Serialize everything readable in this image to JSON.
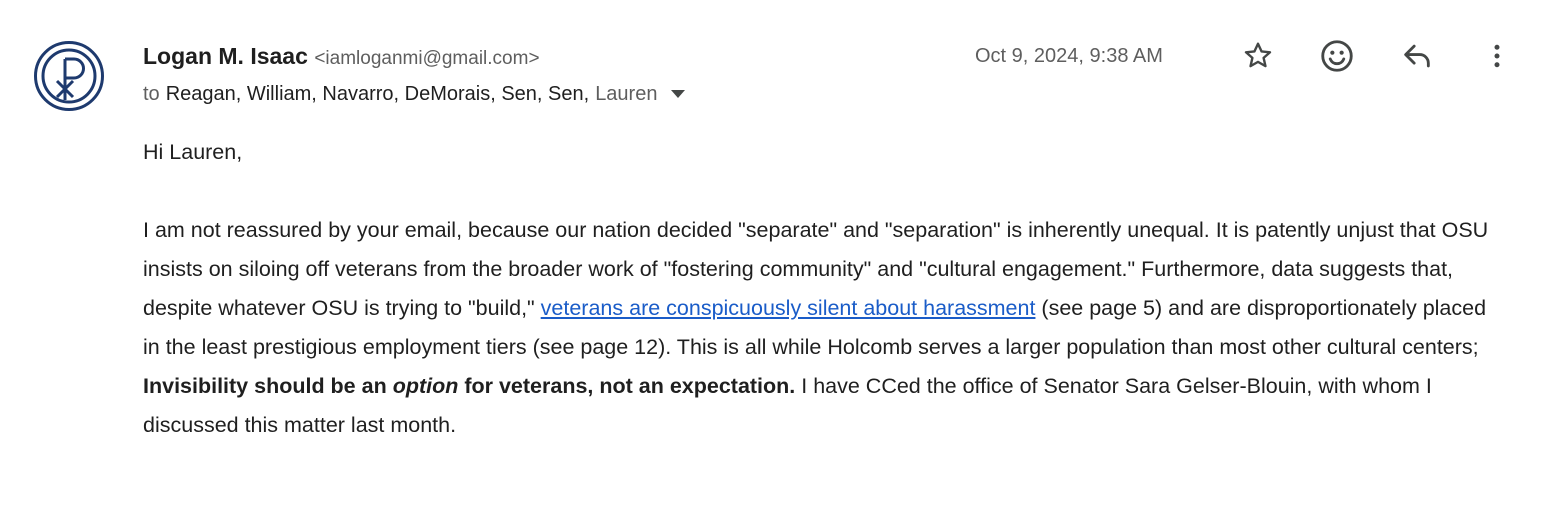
{
  "sender": {
    "name": "Logan M. Isaac",
    "email": "<iamloganmi@gmail.com>",
    "avatar_icon": "chi-rho-logo-icon"
  },
  "recipients": {
    "label": "to",
    "names": "Reagan, William, Navarro, DeMorais, Sen, Sen,",
    "last": "Lauren"
  },
  "date": "Oct 9, 2024, 9:38 AM",
  "actions": {
    "star_icon": "star-icon",
    "emoji_icon": "emoji-react-icon",
    "reply_icon": "reply-icon",
    "more_icon": "more-vert-icon"
  },
  "body": {
    "greeting": "Hi Lauren,",
    "p1_a": "I am not reassured by your email, because our nation decided \"separate\" and \"separation\" is inherently unequal. It is patently unjust that OSU insists on siloing off veterans from the broader work of \"fostering community\" and \"cultural engagement.\" Furthermore, data suggests that, despite whatever OSU is trying to \"build,\" ",
    "p1_link": "veterans are conspicuously silent about harassment",
    "p1_b": " (see page 5) and are disproportionately placed in the least prestigious employment tiers (see page 12). This is all while Holcomb serves a larger population than most other cultural centers; ",
    "p1_bold1": "Invisibility should be an ",
    "p1_bold_italic": "option",
    "p1_bold2": " for veterans, not an expectation.",
    "p1_c": " I have CCed the office of Senator Sara Gelser-Blouin, with whom I discussed this matter last month."
  },
  "colors": {
    "avatar_blue": "#1e3a6e",
    "link_blue": "#1a5cc8",
    "text": "#1f1f1f",
    "muted": "#5e5e5e"
  }
}
